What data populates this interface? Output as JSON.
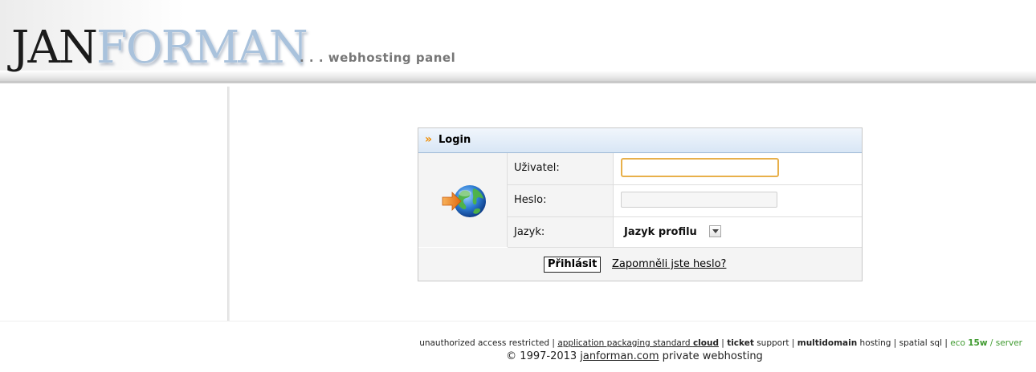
{
  "header": {
    "logo_part1": "JAN",
    "logo_part2": "FORMAN",
    "tagline": ". . . webhosting panel"
  },
  "login": {
    "title_arrows": "»",
    "title": "Login",
    "user_label": "Uživatel:",
    "user_value": "",
    "password_label": "Heslo:",
    "password_value": "",
    "language_label": "Jazyk:",
    "language_value": "Jazyk profilu",
    "submit_label": "Přihlásit",
    "forgot_label": "Zapomněli jste heslo?"
  },
  "footer": {
    "part1": "unauthorized access restricted | ",
    "app_link": "application packaging standard ",
    "app_link_bold": "cloud",
    "sep1": " | ",
    "ticket_bold": "ticket",
    "ticket_rest": " support | ",
    "multidomain_bold": "multidomain",
    "multidomain_rest": " hosting | spatial sql | ",
    "eco_text": "eco ",
    "eco_bold": "15w",
    "eco_rest": " / server",
    "copyright_text": "© 1997-2013 ",
    "copyright_link": "janforman.com",
    "copyright_rest": " private webhosting"
  },
  "colors": {
    "accent_orange": "#f08c00",
    "header_blue": "#d8e6f5",
    "eco_green": "#3f9a2f",
    "focus_border": "#e8b04a"
  },
  "icons": [
    "login-globe-icon",
    "double-chevron-icon",
    "dropdown-arrow-icon"
  ]
}
